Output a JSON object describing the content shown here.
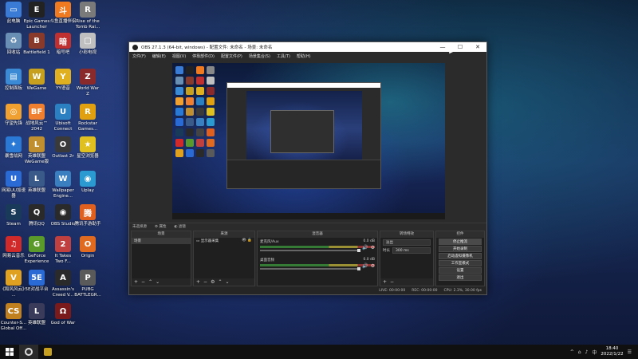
{
  "desktop_icons": [
    {
      "label": "此电脑",
      "color": "#3a7bd5",
      "glyph": "▭",
      "icon": "computer-icon"
    },
    {
      "label": "Epic Games\nLauncher",
      "color": "#222222",
      "glyph": "E",
      "icon": "epic-games-icon"
    },
    {
      "label": "斗鱼直播伴侣",
      "color": "#f07a20",
      "glyph": "斗",
      "icon": "douyu-icon"
    },
    {
      "label": "Rise of the\nTomb Rai...",
      "color": "#7a7a7a",
      "glyph": "R",
      "icon": "tomb-raider-icon"
    },
    {
      "label": "回收站",
      "color": "#6a8fb5",
      "glyph": "♻",
      "icon": "recycle-bin-icon"
    },
    {
      "label": "Battlefield 1",
      "color": "#8a3a2a",
      "glyph": "B",
      "icon": "battlefield-icon"
    },
    {
      "label": "暗号吧",
      "color": "#c03030",
      "glyph": "暗",
      "icon": "game-icon"
    },
    {
      "label": "小彩电视",
      "color": "#c0c0c0",
      "glyph": "▢",
      "icon": "tv-icon"
    },
    {
      "label": "控制面板",
      "color": "#3a8ad5",
      "glyph": "▤",
      "icon": "control-panel-icon"
    },
    {
      "label": "WeGame",
      "color": "#c8a020",
      "glyph": "W",
      "icon": "wegame-icon"
    },
    {
      "label": "YY语音",
      "color": "#e0b020",
      "glyph": "Y",
      "icon": "yy-icon"
    },
    {
      "label": "World War\nZ",
      "color": "#8a2a2a",
      "glyph": "Z",
      "icon": "wwz-icon"
    },
    {
      "label": "守望先锋",
      "color": "#f0a030",
      "glyph": "◎",
      "icon": "overwatch-icon"
    },
    {
      "label": "战地风云™\n2042",
      "color": "#f08030",
      "glyph": "BF",
      "icon": "bf2042-icon"
    },
    {
      "label": "Ubisoft\nConnect",
      "color": "#2a80c0",
      "glyph": "U",
      "icon": "ubisoft-icon"
    },
    {
      "label": "Rockstar\nGames...",
      "color": "#e0a010",
      "glyph": "R",
      "icon": "rockstar-icon"
    },
    {
      "label": "暴雪战网",
      "color": "#2a7ad5",
      "glyph": "✦",
      "icon": "battlenet-icon"
    },
    {
      "label": "英雄联盟\nWeGame版",
      "color": "#c09030",
      "glyph": "L",
      "icon": "lol-icon"
    },
    {
      "label": "Outlast 2r",
      "color": "#3a3a3a",
      "glyph": "O",
      "icon": "outlast-icon"
    },
    {
      "label": "星空浏览器",
      "color": "#e0c020",
      "glyph": "★",
      "icon": "browser-icon"
    },
    {
      "label": "网易UU加速\n器",
      "color": "#2a6ad5",
      "glyph": "U",
      "icon": "uu-icon"
    },
    {
      "label": "英雄联盟",
      "color": "#3a5a8a",
      "glyph": "L",
      "icon": "league-icon"
    },
    {
      "label": "Wallpaper\nEngine...",
      "color": "#3a80c0",
      "glyph": "W",
      "icon": "wallpaper-engine-icon"
    },
    {
      "label": "Uplay",
      "color": "#2a9ad0",
      "glyph": "◉",
      "icon": "uplay-icon"
    },
    {
      "label": "Steam",
      "color": "#1a3a5a",
      "glyph": "S",
      "icon": "steam-icon"
    },
    {
      "label": "腾讯QQ",
      "color": "#2a2a2a",
      "glyph": "Q",
      "icon": "qq-icon"
    },
    {
      "label": "OBS Studio",
      "color": "#2a2a2a",
      "glyph": "◉",
      "icon": "obs-icon"
    },
    {
      "label": "腾讯手游助手",
      "color": "#e06020",
      "glyph": "腾",
      "icon": "tencent-assistant-icon"
    },
    {
      "label": "网易云音乐",
      "color": "#d02a2a",
      "glyph": "♫",
      "icon": "netease-music-icon"
    },
    {
      "label": "GeForce\nExperience",
      "color": "#5a9a2a",
      "glyph": "G",
      "icon": "geforce-icon"
    },
    {
      "label": "It Takes\nTwo F...",
      "color": "#c04040",
      "glyph": "2",
      "icon": "it-takes-two-icon"
    },
    {
      "label": "Origin",
      "color": "#e06a20",
      "glyph": "O",
      "icon": "origin-icon"
    },
    {
      "label": "《和风风云》\n...",
      "color": "#e0a020",
      "glyph": "V",
      "icon": "game2-icon"
    },
    {
      "label": "5E对战平台",
      "color": "#2a6ad5",
      "glyph": "5E",
      "icon": "5e-icon"
    },
    {
      "label": "Assassin's\nCreed V...",
      "color": "#2a2a2a",
      "glyph": "A",
      "icon": "ac-icon"
    },
    {
      "label": "PUBG\nBATTLEGR...",
      "color": "#5a5a5a",
      "glyph": "P",
      "icon": "pubg-icon"
    },
    {
      "label": "Counter-S...\nGlobal Off...",
      "color": "#c08020",
      "glyph": "CS",
      "icon": "csgo-icon"
    },
    {
      "label": "英雄联盟",
      "color": "#3a3a5a",
      "glyph": "L",
      "icon": "league2-icon"
    },
    {
      "label": "God of War",
      "color": "#7a1a1a",
      "glyph": "Ω",
      "icon": "god-of-war-icon"
    }
  ],
  "obs": {
    "title": "OBS 27.1.3 (64-bit, windows) - 配置文件: 未命名 - 场景: 未命名",
    "menus": [
      "文件(F)",
      "编辑(E)",
      "视图(V)",
      "停靠部件(D)",
      "配置文件(P)",
      "场景集合(S)",
      "工具(T)",
      "帮助(H)"
    ],
    "scene_toolbar": {
      "scene_name": "未选择源",
      "properties": "属性",
      "filters": "滤镜"
    },
    "docks": {
      "scenes": {
        "header": "场景",
        "items": [
          "场景"
        ]
      },
      "sources": {
        "header": "来源",
        "items": [
          "显示器采集"
        ]
      },
      "mixer": {
        "header": "混音器",
        "tracks": [
          {
            "name": "麦克风/Aux",
            "db": "0.0 dB"
          },
          {
            "name": "桌面音频",
            "db": "0.0 dB"
          }
        ]
      },
      "transitions": {
        "header": "转场特效",
        "type": "淡出",
        "duration_label": "时长",
        "duration_value": "300 ms"
      },
      "controls": {
        "header": "控件",
        "buttons": [
          "停止推流",
          "开始录制",
          "启动虚拟摄像机",
          "工作室模式",
          "设置",
          "退出"
        ]
      }
    },
    "status": {
      "live": "LIVE: 00:00:00",
      "rec": "REC: 00:00:00",
      "cpu": "CPU: 2.3%, 30.00 fps"
    }
  },
  "taskbar": {
    "time": "18:40",
    "date": "2022/1/22",
    "tray_icons": [
      "^",
      "⌂",
      "♪",
      "中",
      "☰"
    ]
  }
}
